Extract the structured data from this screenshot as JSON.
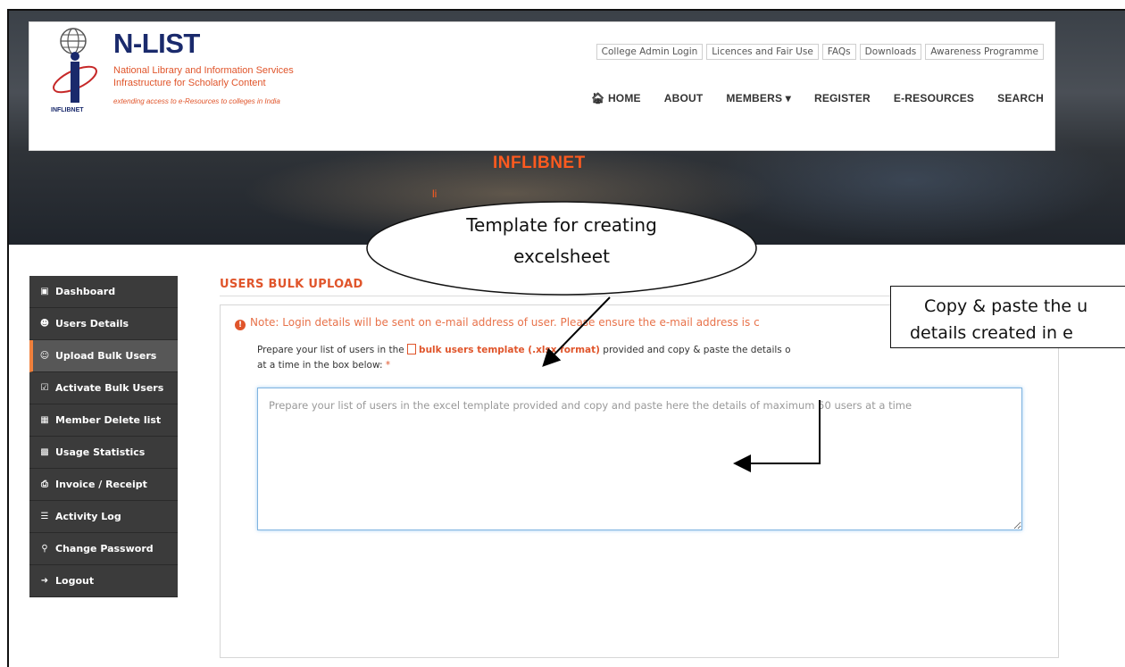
{
  "logo": {
    "title": "N-LIST",
    "line1": "National Library and Information Services",
    "line2": "Infrastructure for Scholarly Content",
    "line3": "extending access to e-Resources to colleges in India",
    "org": "INFLIBNET"
  },
  "toplinks": [
    "College Admin Login",
    "Licences and Fair Use",
    "FAQs",
    "Downloads",
    "Awareness Programme"
  ],
  "nav": {
    "home": "HOME",
    "about": "ABOUT",
    "members": "MEMBERS",
    "register": "REGISTER",
    "eresources": "E-RESOURCES",
    "search": "SEARCH"
  },
  "hero": {
    "title": "INFLIBNET",
    "subtitle": "li"
  },
  "sidebar": {
    "items": [
      {
        "label": "Dashboard",
        "icon": "dashboard-icon"
      },
      {
        "label": "Users Details",
        "icon": "users-icon"
      },
      {
        "label": "Upload Bulk Users",
        "icon": "upload-users-icon"
      },
      {
        "label": "Activate Bulk Users",
        "icon": "check-square-icon"
      },
      {
        "label": "Member Delete list",
        "icon": "trash-icon"
      },
      {
        "label": "Usage Statistics",
        "icon": "bar-chart-icon"
      },
      {
        "label": "Invoice / Receipt",
        "icon": "print-icon"
      },
      {
        "label": "Activity Log",
        "icon": "list-icon"
      },
      {
        "label": "Change Password",
        "icon": "key-icon"
      },
      {
        "label": "Logout",
        "icon": "logout-icon"
      }
    ],
    "active_index": 2
  },
  "content": {
    "title": "USERS BULK UPLOAD",
    "note": "Note: Login details will be sent on e-mail address of user. Please ensure the e-mail address is c",
    "instr_part1": "Prepare your list of users in the",
    "template_link": "bulk users template (.xlsx format)",
    "instr_part2": "provided and copy & paste the details o",
    "instr_part3": "at a time in the box below:",
    "required_mark": "*",
    "paste_placeholder": "Prepare your list of users in the excel template provided and copy and paste here the details of maximum 50 users at a time"
  },
  "callouts": {
    "oval_line1": "Template for creating",
    "oval_line2": "excelsheet",
    "box_line1": "Copy & paste the u",
    "box_line2": "details created in e"
  },
  "colors": {
    "accent": "#e0552b",
    "brand_navy": "#1a2a6c",
    "sidebar_bg": "#3b3b3b",
    "sidebar_active": "#575757"
  }
}
